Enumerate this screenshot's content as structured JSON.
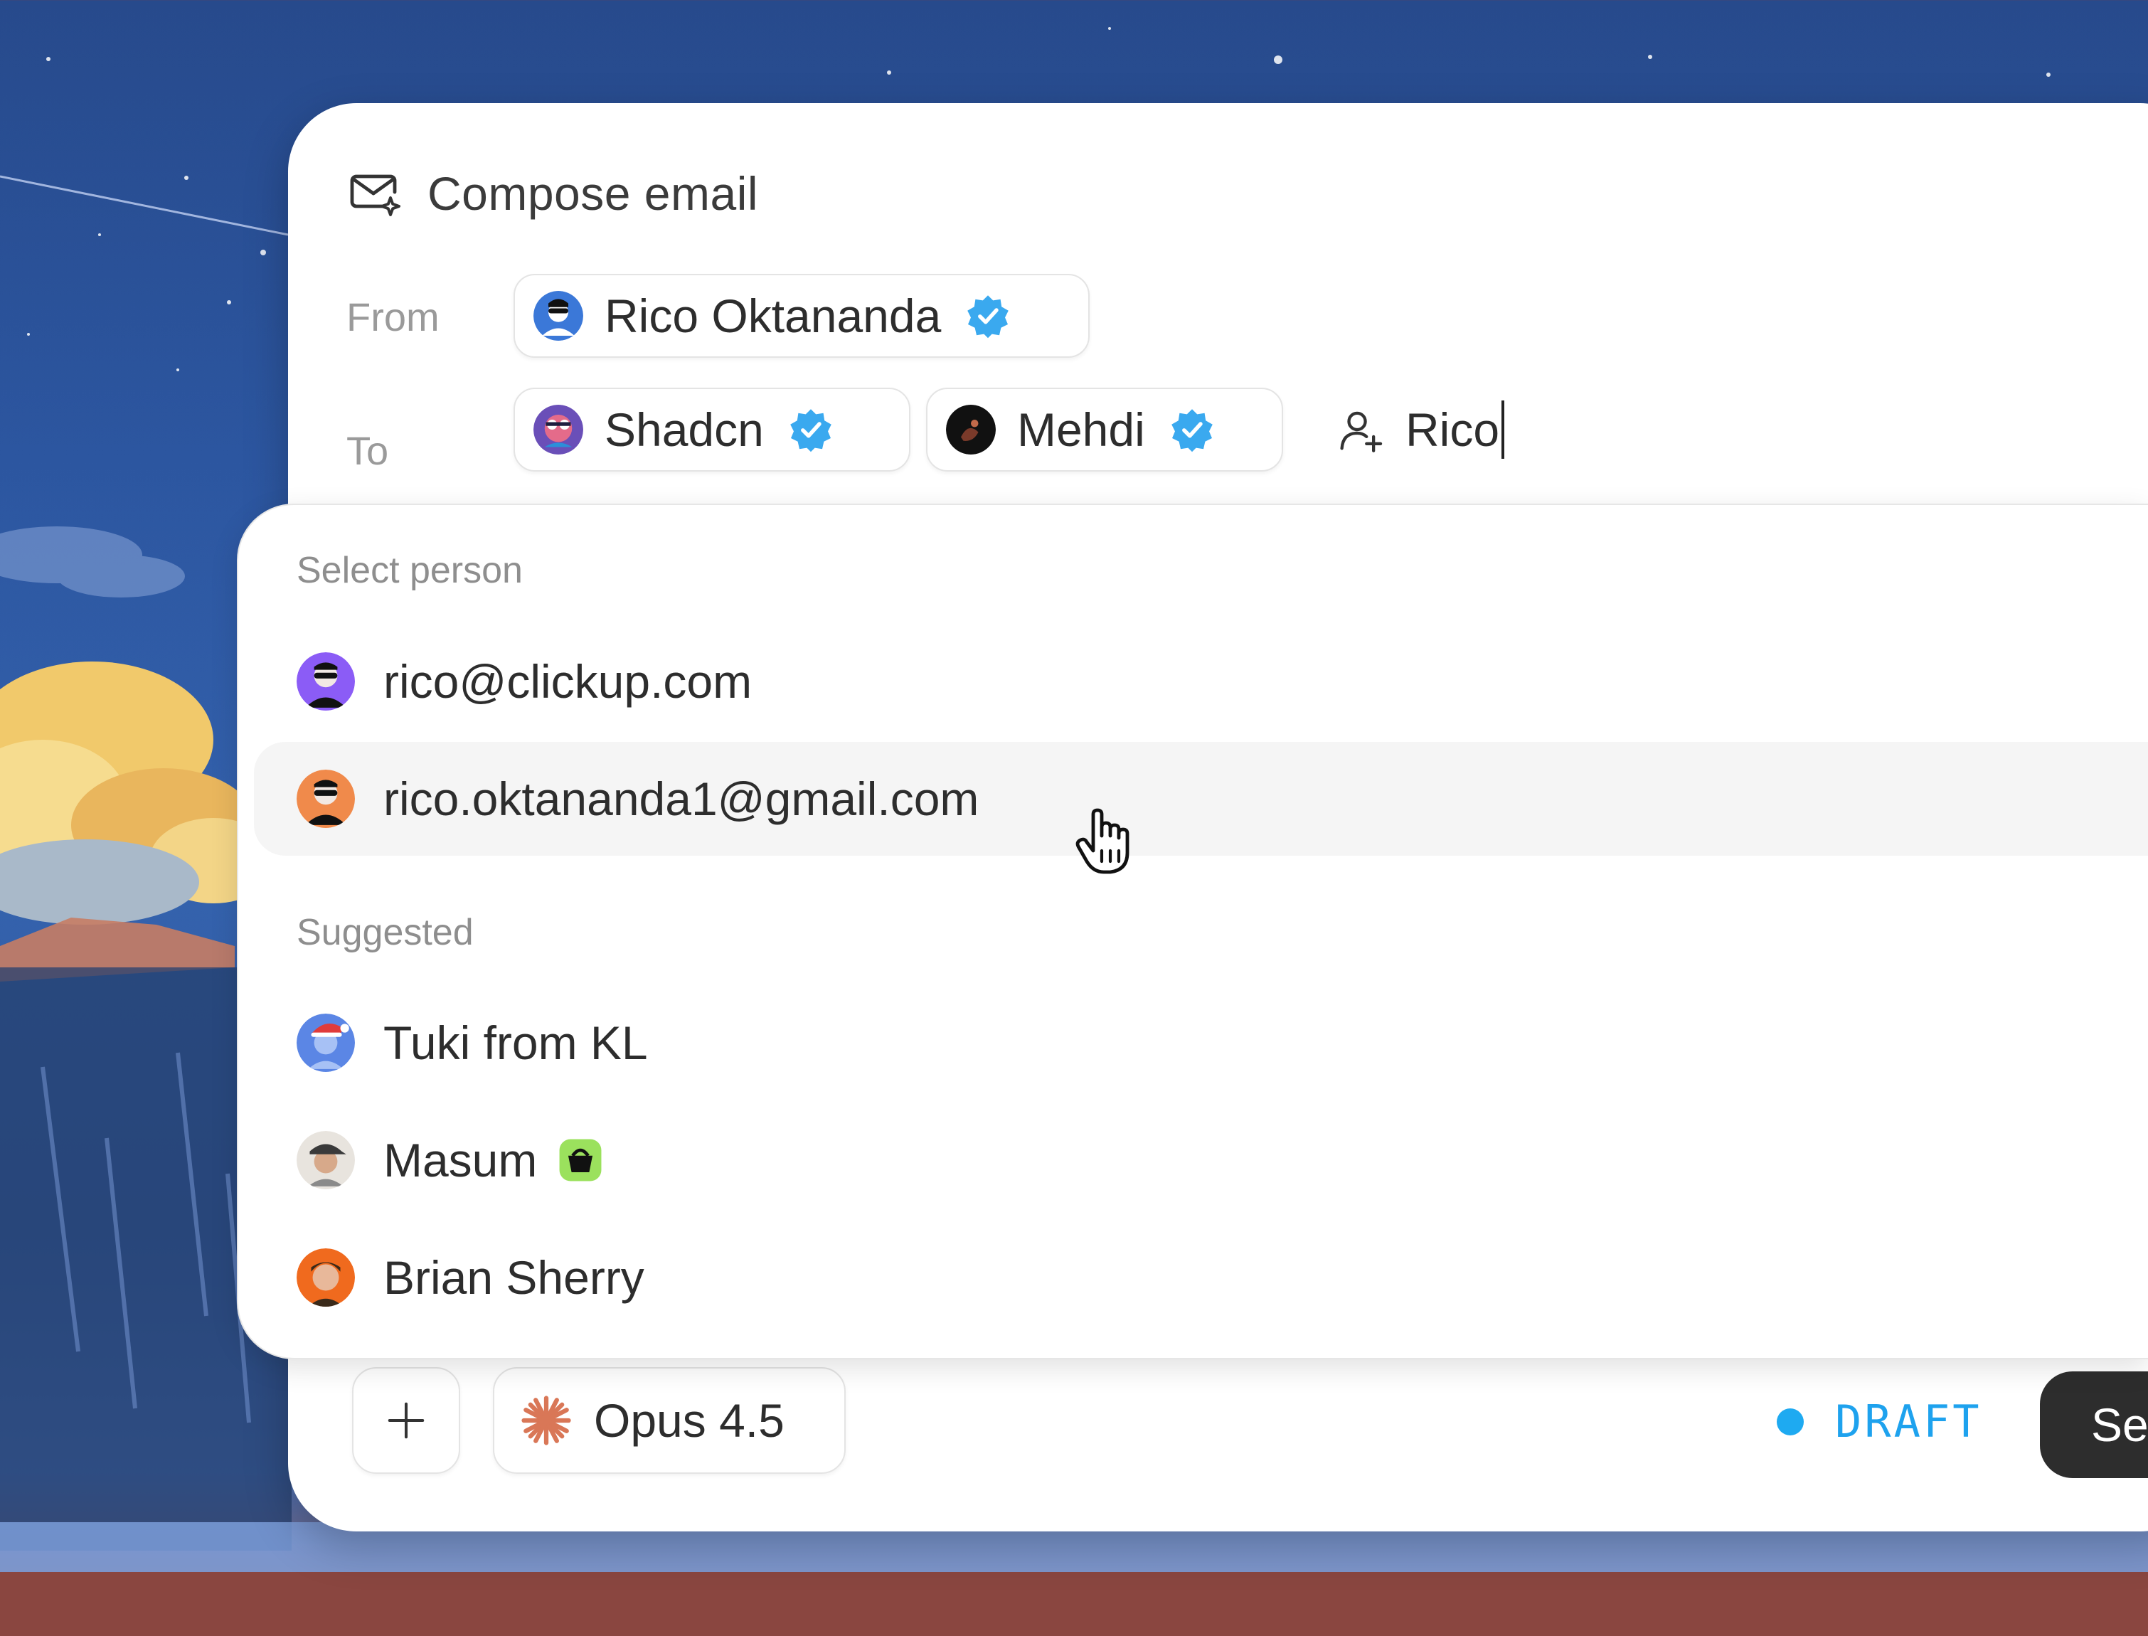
{
  "window": {
    "title": "Compose email",
    "title_icon": "mail-sparkle-icon"
  },
  "from": {
    "label": "From",
    "sender": {
      "name": "Rico Oktananda",
      "verified": true,
      "avatar": "avatar-rico"
    }
  },
  "to": {
    "label": "To",
    "recipients": [
      {
        "name": "Shadcn",
        "verified": true,
        "avatar": "avatar-shadcn"
      },
      {
        "name": "Mehdi",
        "verified": true,
        "avatar": "avatar-mehdi"
      }
    ],
    "input": {
      "icon": "user-plus-icon",
      "value": "Rico"
    }
  },
  "dropdown": {
    "select_label": "Select person",
    "select_items": [
      {
        "label": "rico@clickup.com",
        "avatar_color": "#8b5cf6"
      },
      {
        "label": "rico.oktananda1@gmail.com",
        "avatar_color": "#f08a4b",
        "hovered": true
      }
    ],
    "suggested_label": "Suggested",
    "suggested_items": [
      {
        "label": "Tuki from KL",
        "avatar_color": "#5b86e5"
      },
      {
        "label": "Masum",
        "avatar_color": "#e8e4de",
        "badge_icon": "basket-icon"
      },
      {
        "label": "Brian Sherry",
        "avatar_color": "#f06a1e"
      }
    ]
  },
  "toolbar": {
    "add_icon": "plus-icon",
    "model": {
      "label": "Opus 4.5",
      "icon": "claude-star-icon"
    },
    "status": {
      "label": "DRAFT",
      "color": "#1ea2ee"
    },
    "send_label": "Se"
  },
  "colors": {
    "accent_blue": "#1ea2ee",
    "verified_badge": "#3aa9ef",
    "send_bg": "#2d2d2d"
  }
}
